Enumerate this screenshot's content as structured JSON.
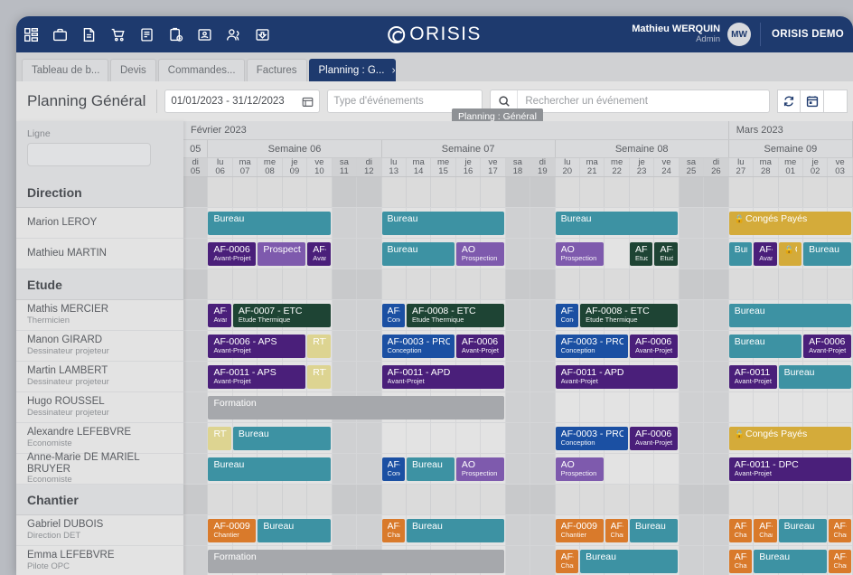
{
  "topbar": {
    "icons": [
      "dashboard-icon",
      "briefcase-icon",
      "document-icon",
      "cart-icon",
      "invoice-icon",
      "clipboard-clock-icon",
      "contact-card-icon",
      "people-icon",
      "inbox-download-icon"
    ],
    "brand": "ORISIS",
    "user_name": "Mathieu WERQUIN",
    "user_role": "Admin",
    "user_initials": "MW",
    "org": "ORISIS DEMO",
    "accent": "#1e3a6e"
  },
  "tabs": [
    {
      "label": "Tableau de b...",
      "active": false,
      "closable": false
    },
    {
      "label": "Devis",
      "active": false,
      "closable": false
    },
    {
      "label": "Commandes...",
      "active": false,
      "closable": false
    },
    {
      "label": "Factures",
      "active": false,
      "closable": false
    },
    {
      "label": "Planning : G...",
      "active": true,
      "closable": true,
      "close": "×"
    }
  ],
  "toolbar": {
    "title": "Planning Général",
    "date_range": "01/01/2023 - 31/12/2023",
    "event_type_placeholder": "Type d'événements",
    "search_placeholder": "Rechercher un événement",
    "tooltip": "Planning : Général",
    "refresh_icon": "refresh-icon",
    "calendar_icon": "calendar-icon"
  },
  "sidebar": {
    "filter_label": "Ligne",
    "filter_value": ""
  },
  "calendar": {
    "months": [
      {
        "label": "Février 2023",
        "cols": 22
      },
      {
        "label": "Mars 2023",
        "cols": 5
      }
    ],
    "weeks": [
      {
        "label": "05",
        "cols": 1
      },
      {
        "label": "Semaine 06",
        "cols": 7
      },
      {
        "label": "Semaine 07",
        "cols": 7
      },
      {
        "label": "Semaine 08",
        "cols": 7
      },
      {
        "label": "Semaine 09",
        "cols": 5
      }
    ],
    "days": [
      {
        "dow": "di",
        "num": "05",
        "weekend": true
      },
      {
        "dow": "lu",
        "num": "06",
        "weekend": false
      },
      {
        "dow": "ma",
        "num": "07",
        "weekend": false
      },
      {
        "dow": "me",
        "num": "08",
        "weekend": false
      },
      {
        "dow": "je",
        "num": "09",
        "weekend": false
      },
      {
        "dow": "ve",
        "num": "10",
        "weekend": false
      },
      {
        "dow": "sa",
        "num": "11",
        "weekend": true
      },
      {
        "dow": "di",
        "num": "12",
        "weekend": true
      },
      {
        "dow": "lu",
        "num": "13",
        "weekend": false
      },
      {
        "dow": "ma",
        "num": "14",
        "weekend": false
      },
      {
        "dow": "me",
        "num": "15",
        "weekend": false
      },
      {
        "dow": "je",
        "num": "16",
        "weekend": false
      },
      {
        "dow": "ve",
        "num": "17",
        "weekend": false
      },
      {
        "dow": "sa",
        "num": "18",
        "weekend": true
      },
      {
        "dow": "di",
        "num": "19",
        "weekend": true
      },
      {
        "dow": "lu",
        "num": "20",
        "weekend": false
      },
      {
        "dow": "ma",
        "num": "21",
        "weekend": false
      },
      {
        "dow": "me",
        "num": "22",
        "weekend": false
      },
      {
        "dow": "je",
        "num": "23",
        "weekend": false
      },
      {
        "dow": "ve",
        "num": "24",
        "weekend": false
      },
      {
        "dow": "sa",
        "num": "25",
        "weekend": true
      },
      {
        "dow": "di",
        "num": "26",
        "weekend": true
      },
      {
        "dow": "lu",
        "num": "27",
        "weekend": false
      },
      {
        "dow": "ma",
        "num": "28",
        "weekend": false
      },
      {
        "dow": "me",
        "num": "01",
        "weekend": false
      },
      {
        "dow": "je",
        "num": "02",
        "weekend": false
      },
      {
        "dow": "ve",
        "num": "03",
        "weekend": false
      }
    ]
  },
  "colors": {
    "bureau": "#3d92a3",
    "avant_projet": "#4a1f7a",
    "prospection": "#7e5aad",
    "etude_thermique": "#1e4434",
    "conception": "#1b50a3",
    "conges": "#d4ab3a",
    "rtt": "#ddd491",
    "formation": "#a6a8ac",
    "chantier": "#d97a2b"
  },
  "rows": [
    {
      "type": "group",
      "label": "Direction"
    },
    {
      "type": "person",
      "name": "Marion LEROY",
      "role": "",
      "events": [
        {
          "title": "Bureau",
          "sub": "",
          "start": 1,
          "span": 5,
          "color": "bureau"
        },
        {
          "title": "Bureau",
          "sub": "",
          "start": 8,
          "span": 5,
          "color": "bureau"
        },
        {
          "title": "Bureau",
          "sub": "",
          "start": 15,
          "span": 5,
          "color": "bureau"
        },
        {
          "title": "Congés Payés",
          "sub": "",
          "start": 22,
          "span": 5,
          "color": "conges",
          "lock": true
        }
      ]
    },
    {
      "type": "person",
      "name": "Mathieu MARTIN",
      "role": "",
      "events": [
        {
          "title": "AF-0006 -",
          "sub": "Avant-Projet",
          "start": 1,
          "span": 2,
          "color": "avant_projet"
        },
        {
          "title": "Prospecti",
          "sub": "",
          "start": 3,
          "span": 2,
          "color": "prospection"
        },
        {
          "title": "AF-",
          "sub": "Avant",
          "start": 5,
          "span": 1,
          "color": "avant_projet"
        },
        {
          "title": "Bureau",
          "sub": "",
          "start": 8,
          "span": 3,
          "color": "bureau"
        },
        {
          "title": "AO",
          "sub": "Prospection",
          "start": 11,
          "span": 2,
          "color": "prospection"
        },
        {
          "title": "AO",
          "sub": "Prospection",
          "start": 15,
          "span": 2,
          "color": "prospection"
        },
        {
          "title": "AF-",
          "sub": "Etude",
          "start": 18,
          "span": 1,
          "color": "etude_thermique"
        },
        {
          "title": "AF-",
          "sub": "Etude",
          "start": 19,
          "span": 1,
          "color": "etude_thermique"
        },
        {
          "title": "Bur",
          "sub": "",
          "start": 22,
          "span": 1,
          "color": "bureau"
        },
        {
          "title": "AF-",
          "sub": "Avant",
          "start": 23,
          "span": 1,
          "color": "avant_projet"
        },
        {
          "title": "Cɔ",
          "sub": "",
          "start": 24,
          "span": 1,
          "color": "conges",
          "lock": true
        },
        {
          "title": "Bureau",
          "sub": "",
          "start": 25,
          "span": 2,
          "color": "bureau"
        }
      ]
    },
    {
      "type": "group",
      "label": "Etude"
    },
    {
      "type": "person",
      "name": "Mathis MERCIER",
      "role": "Thermicien",
      "events": [
        {
          "title": "AF-",
          "sub": "Avant",
          "start": 1,
          "span": 1,
          "color": "avant_projet"
        },
        {
          "title": "AF-0007 - ETC",
          "sub": "Etude Thermique",
          "start": 2,
          "span": 4,
          "color": "etude_thermique"
        },
        {
          "title": "AF-",
          "sub": "Conce",
          "start": 8,
          "span": 1,
          "color": "conception"
        },
        {
          "title": "AF-0008 - ETC",
          "sub": "Etude Thermique",
          "start": 9,
          "span": 4,
          "color": "etude_thermique"
        },
        {
          "title": "AF-",
          "sub": "Conce",
          "start": 15,
          "span": 1,
          "color": "conception"
        },
        {
          "title": "AF-0008 - ETC",
          "sub": "Etude Thermique",
          "start": 16,
          "span": 4,
          "color": "etude_thermique"
        },
        {
          "title": "Bureau",
          "sub": "",
          "start": 22,
          "span": 5,
          "color": "bureau"
        }
      ]
    },
    {
      "type": "person",
      "name": "Manon GIRARD",
      "role": "Dessinateur projeteur",
      "events": [
        {
          "title": "AF-0006 - APS",
          "sub": "Avant-Projet",
          "start": 1,
          "span": 4,
          "color": "avant_projet"
        },
        {
          "title": "RTT",
          "sub": "",
          "start": 5,
          "span": 1,
          "color": "rtt"
        },
        {
          "title": "AF-0003 - PRO",
          "sub": "Conception",
          "start": 8,
          "span": 3,
          "color": "conception"
        },
        {
          "title": "AF-0006 -",
          "sub": "Avant-Projet",
          "start": 11,
          "span": 2,
          "color": "avant_projet"
        },
        {
          "title": "AF-0003 - PRO",
          "sub": "Conception",
          "start": 15,
          "span": 3,
          "color": "conception"
        },
        {
          "title": "AF-0006 -",
          "sub": "Avant-Projet",
          "start": 18,
          "span": 2,
          "color": "avant_projet"
        },
        {
          "title": "Bureau",
          "sub": "",
          "start": 22,
          "span": 3,
          "color": "bureau"
        },
        {
          "title": "AF-0006 -",
          "sub": "Avant-Projet",
          "start": 25,
          "span": 2,
          "color": "avant_projet"
        }
      ]
    },
    {
      "type": "person",
      "name": "Martin LAMBERT",
      "role": "Dessinateur projeteur",
      "events": [
        {
          "title": "AF-0011 - APS",
          "sub": "Avant-Projet",
          "start": 1,
          "span": 4,
          "color": "avant_projet"
        },
        {
          "title": "RTT",
          "sub": "",
          "start": 5,
          "span": 1,
          "color": "rtt"
        },
        {
          "title": "AF-0011 - APD",
          "sub": "Avant-Projet",
          "start": 8,
          "span": 5,
          "color": "avant_projet"
        },
        {
          "title": "AF-0011 - APD",
          "sub": "Avant-Projet",
          "start": 15,
          "span": 5,
          "color": "avant_projet"
        },
        {
          "title": "AF-0011 - ,",
          "sub": "Avant-Projet",
          "start": 22,
          "span": 2,
          "color": "avant_projet"
        },
        {
          "title": "Bureau",
          "sub": "",
          "start": 24,
          "span": 3,
          "color": "bureau"
        }
      ]
    },
    {
      "type": "person",
      "name": "Hugo ROUSSEL",
      "role": "Dessinateur projeteur",
      "events": [
        {
          "title": "Formation",
          "sub": "",
          "start": 1,
          "span": 12,
          "color": "formation"
        }
      ]
    },
    {
      "type": "person",
      "name": "Alexandre LEFEBVRE",
      "role": "Economiste",
      "events": [
        {
          "title": "RTT",
          "sub": "",
          "start": 1,
          "span": 1,
          "color": "rtt"
        },
        {
          "title": "Bureau",
          "sub": "",
          "start": 2,
          "span": 4,
          "color": "bureau"
        },
        {
          "title": "AF-0003 - PRO",
          "sub": "Conception",
          "start": 15,
          "span": 3,
          "color": "conception"
        },
        {
          "title": "AF-0006 -",
          "sub": "Avant-Projet",
          "start": 18,
          "span": 2,
          "color": "avant_projet"
        },
        {
          "title": "Congés Payés",
          "sub": "",
          "start": 22,
          "span": 5,
          "color": "conges",
          "lock": true
        }
      ]
    },
    {
      "type": "person",
      "name": "Anne-Marie DE MARIEL BRUYER",
      "role": "Economiste",
      "events": [
        {
          "title": "Bureau",
          "sub": "",
          "start": 1,
          "span": 5,
          "color": "bureau"
        },
        {
          "title": "AF-",
          "sub": "Conce",
          "start": 8,
          "span": 1,
          "color": "conception"
        },
        {
          "title": "Bureau",
          "sub": "",
          "start": 9,
          "span": 2,
          "color": "bureau"
        },
        {
          "title": "AO",
          "sub": "Prospection",
          "start": 11,
          "span": 2,
          "color": "prospection"
        },
        {
          "title": "AO",
          "sub": "Prospection",
          "start": 15,
          "span": 2,
          "color": "prospection"
        },
        {
          "title": "AF-0011 - DPC",
          "sub": "Avant-Projet",
          "start": 22,
          "span": 5,
          "color": "avant_projet"
        }
      ]
    },
    {
      "type": "group",
      "label": "Chantier"
    },
    {
      "type": "person",
      "name": "Gabriel DUBOIS",
      "role": "Direction DET",
      "events": [
        {
          "title": "AF-0009 -",
          "sub": "Chantier",
          "start": 1,
          "span": 2,
          "color": "chantier"
        },
        {
          "title": "Bureau",
          "sub": "",
          "start": 3,
          "span": 3,
          "color": "bureau"
        },
        {
          "title": "AF-",
          "sub": "Chant",
          "start": 8,
          "span": 1,
          "color": "chantier"
        },
        {
          "title": "Bureau",
          "sub": "",
          "start": 9,
          "span": 4,
          "color": "bureau"
        },
        {
          "title": "AF-0009 -",
          "sub": "Chantier",
          "start": 15,
          "span": 2,
          "color": "chantier"
        },
        {
          "title": "AF-",
          "sub": "Chant",
          "start": 17,
          "span": 1,
          "color": "chantier"
        },
        {
          "title": "Bureau",
          "sub": "",
          "start": 18,
          "span": 2,
          "color": "bureau"
        },
        {
          "title": "AF-",
          "sub": "Chant",
          "start": 22,
          "span": 1,
          "color": "chantier"
        },
        {
          "title": "AF-",
          "sub": "Chant",
          "start": 23,
          "span": 1,
          "color": "chantier"
        },
        {
          "title": "Bureau",
          "sub": "",
          "start": 24,
          "span": 2,
          "color": "bureau"
        },
        {
          "title": "AF-",
          "sub": "Chant",
          "start": 26,
          "span": 1,
          "color": "chantier"
        }
      ]
    },
    {
      "type": "person",
      "name": "Emma LEFEBVRE",
      "role": "Pilote OPC",
      "events": [
        {
          "title": "Formation",
          "sub": "",
          "start": 1,
          "span": 12,
          "color": "formation"
        },
        {
          "title": "AF-",
          "sub": "Chant",
          "start": 15,
          "span": 1,
          "color": "chantier"
        },
        {
          "title": "Bureau",
          "sub": "",
          "start": 16,
          "span": 4,
          "color": "bureau"
        },
        {
          "title": "AF-",
          "sub": "Chant",
          "start": 22,
          "span": 1,
          "color": "chantier"
        },
        {
          "title": "Bureau",
          "sub": "",
          "start": 23,
          "span": 3,
          "color": "bureau"
        },
        {
          "title": "AF-",
          "sub": "Chant",
          "start": 26,
          "span": 1,
          "color": "chantier"
        }
      ]
    }
  ]
}
